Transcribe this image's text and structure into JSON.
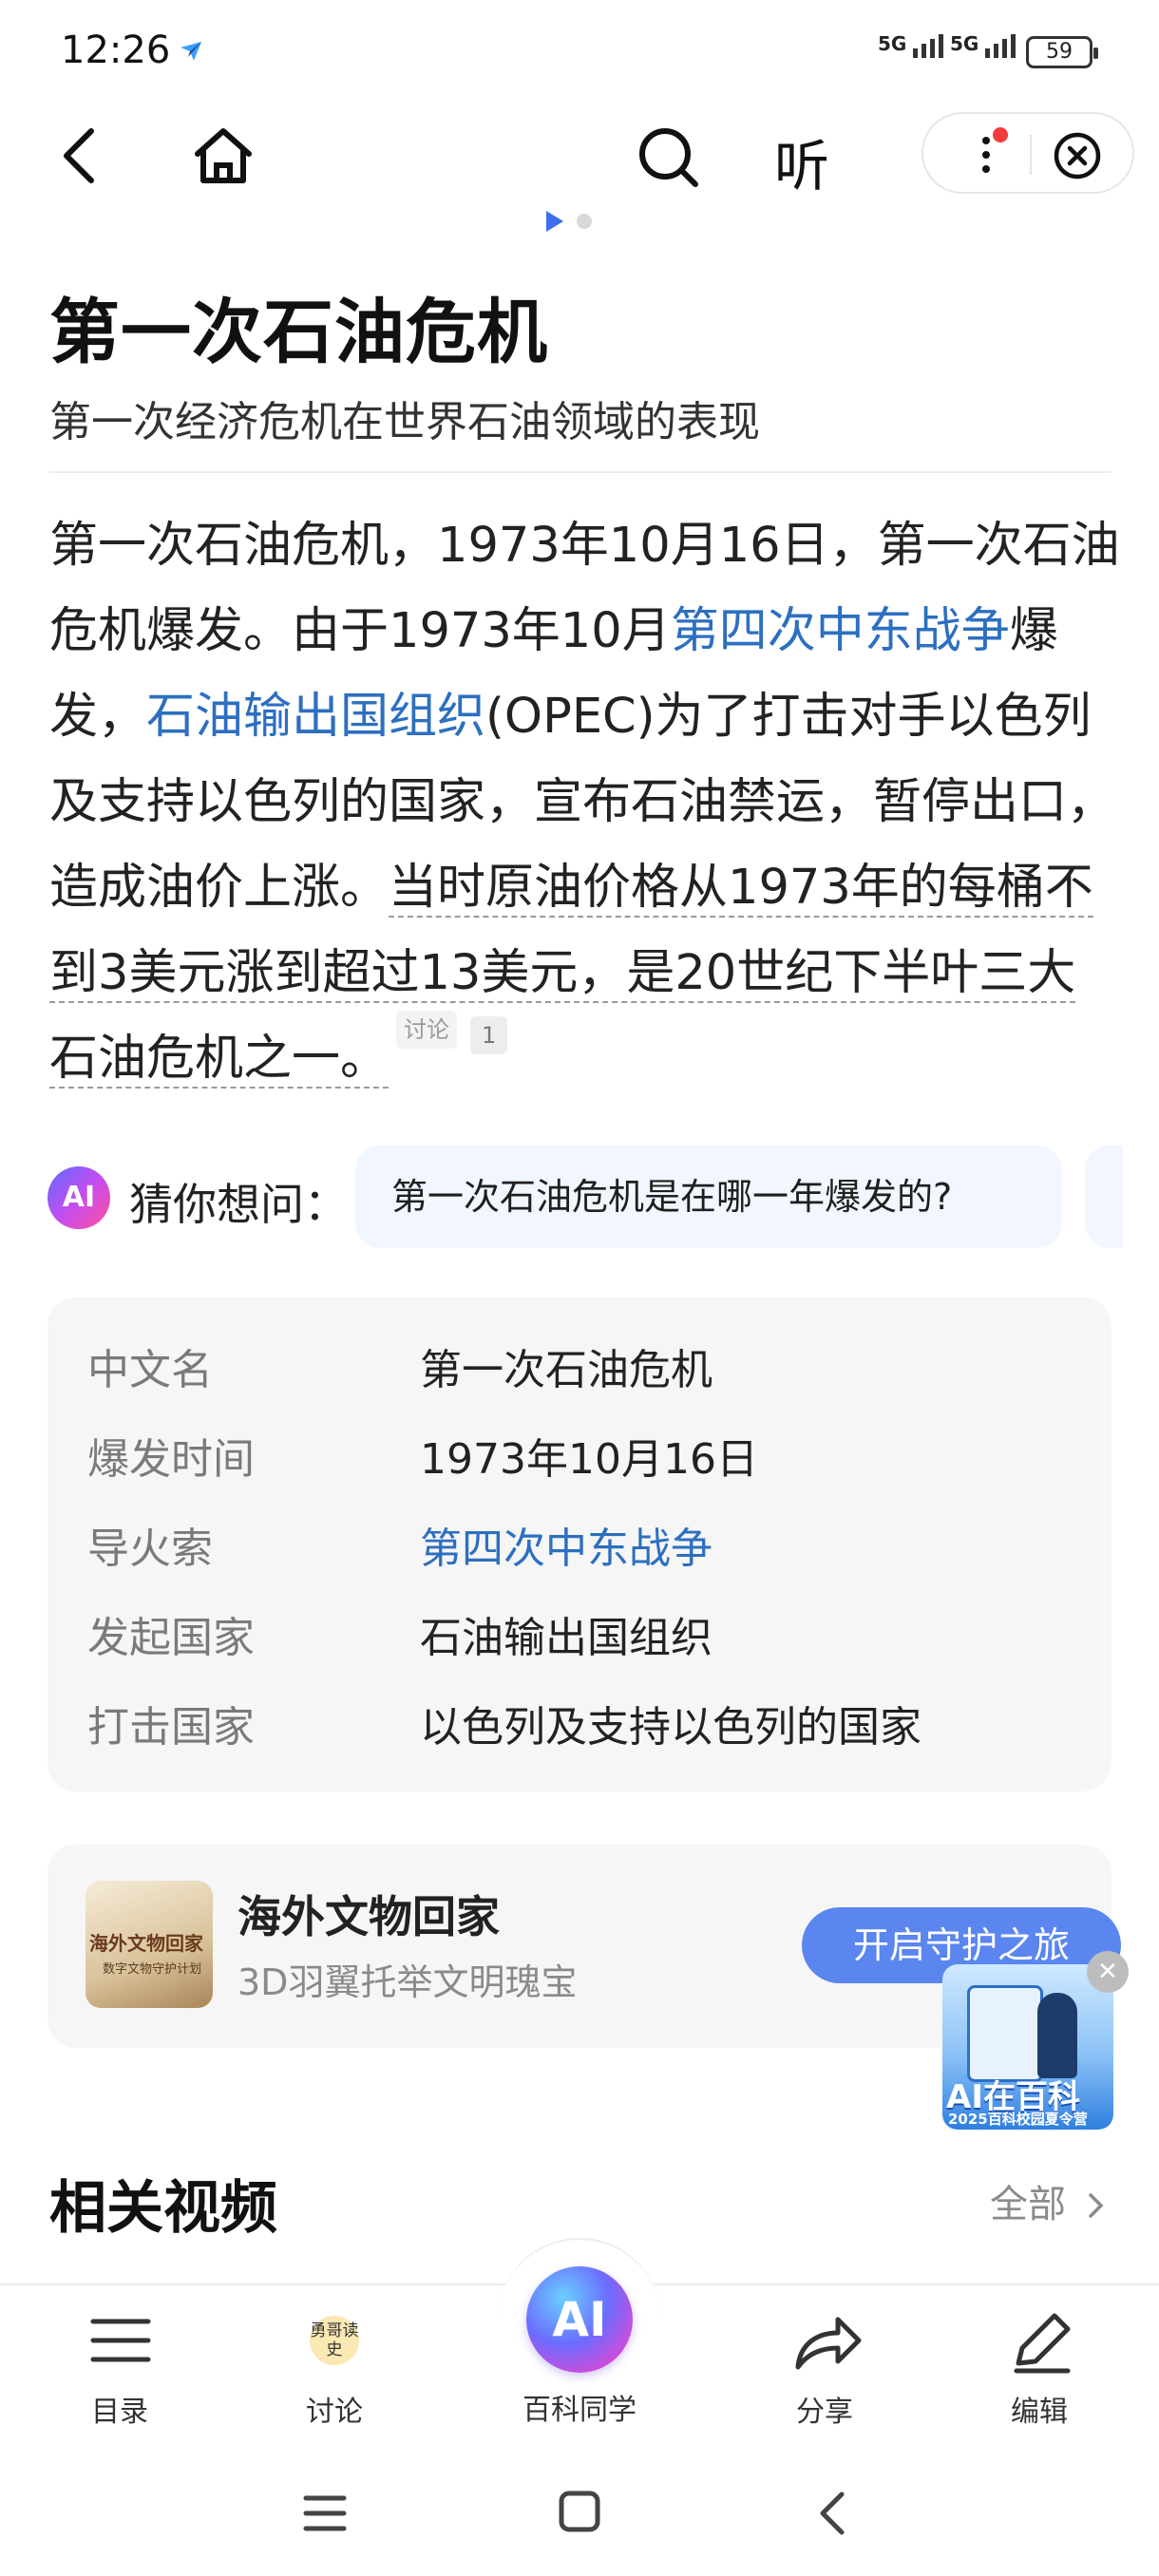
{
  "status_bar": {
    "time": "12:26",
    "signal_1": "5G",
    "signal_2": "5G",
    "battery": "59"
  },
  "top_nav": {
    "listen_label": "听"
  },
  "article": {
    "title": "第一次石油危机",
    "subtitle": "第一次经济危机在世界石油领域的表现",
    "summary": {
      "part1": "第一次石油危机，1973年10月16日，第一次石油危机爆发。由于1973年10月",
      "link1": "第四次中东战争",
      "part2": "爆发，",
      "link2": "石油输出国组织",
      "part3": "(OPEC)为了打击对手以色列及支持以色列的国家，宣布石油禁运，暂停出口，造成油价上涨。",
      "underlined": "当时原油价格从1973年的每桶不到3美元涨到超过13美元，是20世纪下半叶三大石油危机之一。",
      "discuss_badge": "讨论",
      "discuss_count": "1"
    }
  },
  "guess": {
    "label": "猜你想问：",
    "question": "第一次石油危机是在哪一年爆发的?"
  },
  "infobox": {
    "rows": [
      {
        "key": "中文名",
        "value": "第一次石油危机"
      },
      {
        "key": "爆发时间",
        "value": "1973年10月16日"
      },
      {
        "key": "导火索",
        "value": "第四次中东战争"
      },
      {
        "key": "发起国家",
        "value": "石油输出国组织"
      },
      {
        "key": "打击国家",
        "value": "以色列及支持以色列的国家"
      }
    ]
  },
  "promo": {
    "image_title": "海外文物回家",
    "image_sub": "数字文物守护计划",
    "title": "海外文物回家",
    "subtitle": "3D羽翼托举文明瑰宝",
    "button": "开启守护之旅"
  },
  "ai_banner": {
    "title": "AI在百科",
    "subtitle": "2025百科校园夏令营"
  },
  "related": {
    "title": "相关视频",
    "all": "全部"
  },
  "bottom_bar": {
    "catalog": "目录",
    "discuss": "讨论",
    "yongge": "勇哥读史",
    "ai": "百科同学",
    "share": "分享",
    "edit": "编辑"
  },
  "colors": {
    "link": "#2d6fc0",
    "accent": "#5b86ef",
    "chip_bg": "#f1f6ff",
    "card_bg": "#f6f6f6"
  }
}
